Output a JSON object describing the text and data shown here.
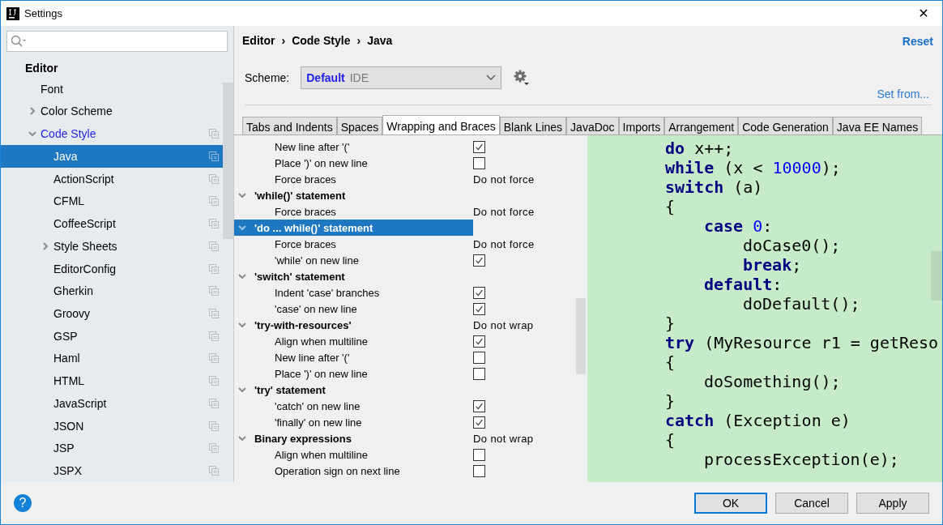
{
  "window": {
    "title": "Settings",
    "close": "✕"
  },
  "sidebar": {
    "section": "Editor",
    "items": [
      {
        "label": "Font",
        "selected": false,
        "modified": false,
        "copyable": false
      },
      {
        "label": "Color Scheme",
        "selected": false,
        "modified": false,
        "copyable": false,
        "expanded": false
      },
      {
        "label": "Code Style",
        "selected": false,
        "modified": true,
        "copyable": true,
        "expanded": true,
        "children": [
          {
            "label": "Java",
            "selected": true,
            "modified": false,
            "copyable": true
          },
          {
            "label": "ActionScript",
            "selected": false,
            "modified": false,
            "copyable": true
          },
          {
            "label": "CFML",
            "selected": false,
            "modified": false,
            "copyable": true
          },
          {
            "label": "CoffeeScript",
            "selected": false,
            "modified": false,
            "copyable": true
          },
          {
            "label": "Style Sheets",
            "selected": false,
            "modified": false,
            "copyable": true,
            "expanded": false
          },
          {
            "label": "EditorConfig",
            "selected": false,
            "modified": false,
            "copyable": true
          },
          {
            "label": "Gherkin",
            "selected": false,
            "modified": false,
            "copyable": true
          },
          {
            "label": "Groovy",
            "selected": false,
            "modified": false,
            "copyable": true
          },
          {
            "label": "GSP",
            "selected": false,
            "modified": false,
            "copyable": true
          },
          {
            "label": "Haml",
            "selected": false,
            "modified": false,
            "copyable": true
          },
          {
            "label": "HTML",
            "selected": false,
            "modified": false,
            "copyable": true
          },
          {
            "label": "JavaScript",
            "selected": false,
            "modified": false,
            "copyable": true
          },
          {
            "label": "JSON",
            "selected": false,
            "modified": false,
            "copyable": true
          },
          {
            "label": "JSP",
            "selected": false,
            "modified": false,
            "copyable": true
          },
          {
            "label": "JSPX",
            "selected": false,
            "modified": false,
            "copyable": true
          }
        ]
      }
    ]
  },
  "breadcrumb": [
    "Editor",
    "Code Style",
    "Java"
  ],
  "breadcrumb_separator": "›",
  "reset": "Reset",
  "scheme": {
    "label": "Scheme:",
    "name": "Default",
    "type": "IDE"
  },
  "set_from": "Set from...",
  "tabs": [
    {
      "label": "Tabs and Indents",
      "selected": false
    },
    {
      "label": "Spaces",
      "selected": false
    },
    {
      "label": "Wrapping and Braces",
      "selected": true
    },
    {
      "label": "Blank Lines",
      "selected": false
    },
    {
      "label": "JavaDoc",
      "selected": false
    },
    {
      "label": "Imports",
      "selected": false
    },
    {
      "label": "Arrangement",
      "selected": false
    },
    {
      "label": "Code Generation",
      "selected": false
    },
    {
      "label": "Java EE Names",
      "selected": false
    }
  ],
  "options": [
    {
      "kind": "checkbox",
      "label": "New line after '('",
      "checked": true
    },
    {
      "kind": "checkbox",
      "label": "Place ')' on new line",
      "checked": false
    },
    {
      "kind": "value",
      "label": "Force braces",
      "value": "Do not force"
    },
    {
      "kind": "group",
      "label": "'while()' statement",
      "expanded": true,
      "selected": false,
      "children": [
        {
          "kind": "value",
          "label": "Force braces",
          "value": "Do not force"
        }
      ]
    },
    {
      "kind": "group",
      "label": "'do ... while()' statement",
      "expanded": true,
      "selected": true,
      "children": [
        {
          "kind": "value",
          "label": "Force braces",
          "value": "Do not force"
        },
        {
          "kind": "checkbox",
          "label": "'while' on new line",
          "checked": true
        }
      ]
    },
    {
      "kind": "group",
      "label": "'switch' statement",
      "expanded": true,
      "selected": false,
      "children": [
        {
          "kind": "checkbox",
          "label": "Indent 'case' branches",
          "checked": true
        },
        {
          "kind": "checkbox",
          "label": "'case' on new line",
          "checked": true
        }
      ]
    },
    {
      "kind": "group",
      "label": "'try-with-resources'",
      "value": "Do not wrap",
      "expanded": true,
      "selected": false,
      "children": [
        {
          "kind": "checkbox",
          "label": "Align when multiline",
          "checked": true
        },
        {
          "kind": "checkbox",
          "label": "New line after '('",
          "checked": false
        },
        {
          "kind": "checkbox",
          "label": "Place ')' on new line",
          "checked": false
        }
      ]
    },
    {
      "kind": "group",
      "label": "'try' statement",
      "expanded": true,
      "selected": false,
      "children": [
        {
          "kind": "checkbox",
          "label": "'catch' on new line",
          "checked": true
        },
        {
          "kind": "checkbox",
          "label": "'finally' on new line",
          "checked": true
        }
      ]
    },
    {
      "kind": "group",
      "label": "Binary expressions",
      "value": "Do not wrap",
      "expanded": true,
      "selected": false,
      "children": [
        {
          "kind": "checkbox",
          "label": "Align when multiline",
          "checked": false
        },
        {
          "kind": "checkbox",
          "label": "Operation sign on next line",
          "checked": false
        }
      ]
    }
  ],
  "code": [
    {
      "tokens": [
        {
          "kind": "keyword",
          "text": "do"
        },
        {
          "kind": "plain",
          "text": " x++;"
        }
      ]
    },
    {
      "tokens": [
        {
          "kind": "keyword",
          "text": "while"
        },
        {
          "kind": "plain",
          "text": " (x < "
        },
        {
          "kind": "number",
          "text": "10000"
        },
        {
          "kind": "plain",
          "text": ");"
        }
      ]
    },
    {
      "tokens": [
        {
          "kind": "keyword",
          "text": "switch"
        },
        {
          "kind": "plain",
          "text": " (a)"
        }
      ]
    },
    {
      "tokens": [
        {
          "kind": "plain",
          "text": "{"
        }
      ],
      "children": [
        {
          "tokens": [
            {
              "kind": "keyword",
              "text": "case"
            },
            {
              "kind": "number",
              "text": "0",
              "space_before": true
            },
            {
              "kind": "plain",
              "text": ":"
            }
          ],
          "children": [
            {
              "tokens": [
                {
                  "kind": "plain",
                  "text": "doCase0();"
                }
              ]
            },
            {
              "tokens": [
                {
                  "kind": "keyword",
                  "text": "break"
                },
                {
                  "kind": "plain",
                  "text": ";"
                }
              ]
            }
          ]
        },
        {
          "tokens": [
            {
              "kind": "keyword",
              "text": "default"
            },
            {
              "kind": "plain",
              "text": ":"
            }
          ],
          "children": [
            {
              "tokens": [
                {
                  "kind": "plain",
                  "text": "doDefault();"
                }
              ]
            }
          ]
        }
      ]
    },
    {
      "tokens": [
        {
          "kind": "plain",
          "text": "}"
        }
      ]
    },
    {
      "tokens": [
        {
          "kind": "keyword",
          "text": "try"
        },
        {
          "kind": "plain",
          "text": " (MyResource r1 = getReso"
        }
      ]
    },
    {
      "tokens": [
        {
          "kind": "plain",
          "text": "{"
        }
      ],
      "children": [
        {
          "tokens": [
            {
              "kind": "plain",
              "text": "doSomething();"
            }
          ]
        }
      ]
    },
    {
      "tokens": [
        {
          "kind": "plain",
          "text": "}"
        }
      ]
    },
    {
      "tokens": [
        {
          "kind": "keyword",
          "text": "catch"
        },
        {
          "kind": "plain",
          "text": " (Exception e)"
        }
      ]
    },
    {
      "tokens": [
        {
          "kind": "plain",
          "text": "{"
        }
      ],
      "children": [
        {
          "tokens": [
            {
              "kind": "plain",
              "text": "processException(e);"
            }
          ]
        }
      ]
    }
  ],
  "help": "?",
  "buttons": [
    {
      "label": "OK",
      "default": true
    },
    {
      "label": "Cancel",
      "default": false
    },
    {
      "label": "Apply",
      "default": false
    }
  ]
}
